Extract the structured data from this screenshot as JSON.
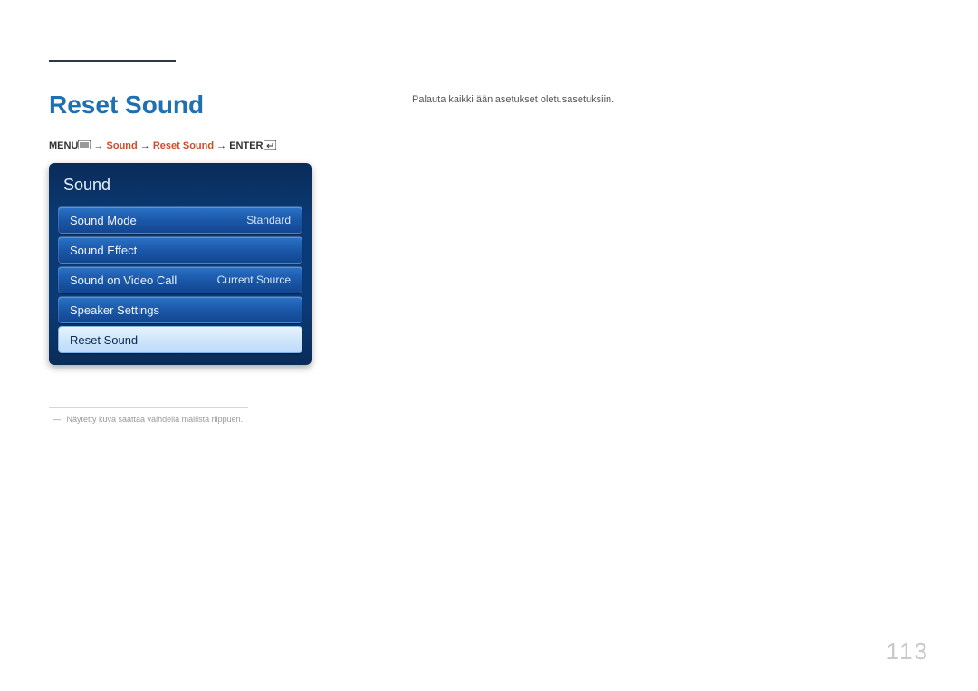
{
  "heading": "Reset Sound",
  "description": "Palauta kaikki ääniasetukset oletusasetuksiin.",
  "breadcrumb": {
    "menu_label": "MENU",
    "arrow": " → ",
    "item1": "Sound",
    "item2": "Reset Sound",
    "enter_label": "ENTER"
  },
  "osd": {
    "title": "Sound",
    "items": [
      {
        "label": "Sound Mode",
        "value": "Standard",
        "selected": false
      },
      {
        "label": "Sound Effect",
        "value": "",
        "selected": false
      },
      {
        "label": "Sound on Video Call",
        "value": "Current Source",
        "selected": false
      },
      {
        "label": "Speaker Settings",
        "value": "",
        "selected": false
      },
      {
        "label": "Reset Sound",
        "value": "",
        "selected": true
      }
    ]
  },
  "footnote": "Näytetty kuva saattaa vaihdella mallista riippuen.",
  "page_number": "113"
}
